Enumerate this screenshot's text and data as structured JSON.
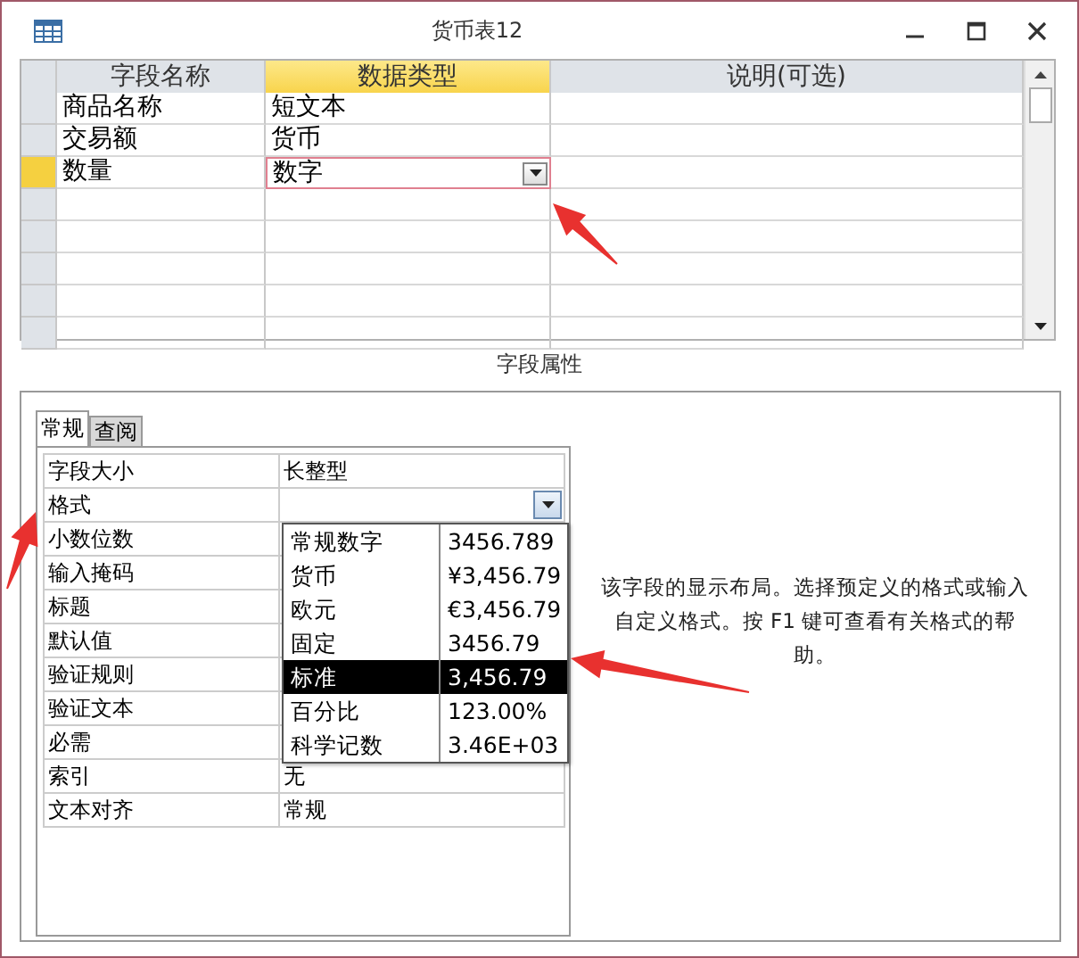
{
  "window": {
    "title": "货币表12"
  },
  "table": {
    "columns": [
      {
        "label": "字段名称",
        "selected": false
      },
      {
        "label": "数据类型",
        "selected": true
      },
      {
        "label": "说明(可选)",
        "selected": false
      }
    ],
    "rows": [
      {
        "name": "商品名称",
        "type": "短文本",
        "selected": false
      },
      {
        "name": "交易额",
        "type": "货币",
        "selected": false
      },
      {
        "name": "数量",
        "type": "数字",
        "selected": true
      }
    ]
  },
  "section_label": "字段属性",
  "tabs": [
    {
      "label": "常规",
      "selected": true
    },
    {
      "label": "查阅",
      "selected": false
    }
  ],
  "properties": [
    {
      "label": "字段大小",
      "value": "长整型",
      "kind": "text"
    },
    {
      "label": "格式",
      "kind": "dropdown"
    },
    {
      "label": "小数位数",
      "kind": "text"
    },
    {
      "label": "输入掩码",
      "kind": "text"
    },
    {
      "label": "标题",
      "kind": "text"
    },
    {
      "label": "默认值",
      "kind": "text"
    },
    {
      "label": "验证规则",
      "kind": "text"
    },
    {
      "label": "验证文本",
      "kind": "text"
    },
    {
      "label": "必需",
      "kind": "text"
    },
    {
      "label": "索引",
      "value": "无",
      "kind": "text"
    },
    {
      "label": "文本对齐",
      "value": "常规",
      "kind": "text"
    }
  ],
  "format_options": [
    {
      "name": "常规数字",
      "sample": "3456.789",
      "selected": false
    },
    {
      "name": "货币",
      "sample": "¥3,456.79",
      "selected": false
    },
    {
      "name": "欧元",
      "sample": "€3,456.79",
      "selected": false
    },
    {
      "name": "固定",
      "sample": "3456.79",
      "selected": false
    },
    {
      "name": "标准",
      "sample": "3,456.79",
      "selected": true
    },
    {
      "name": "百分比",
      "sample": "123.00%",
      "selected": false
    },
    {
      "name": "科学记数",
      "sample": "3.46E+03",
      "selected": false
    }
  ],
  "help_text": "该字段的显示布局。选择预定义的格式或输入自定义格式。按 F1 键可查看有关格式的帮助。"
}
